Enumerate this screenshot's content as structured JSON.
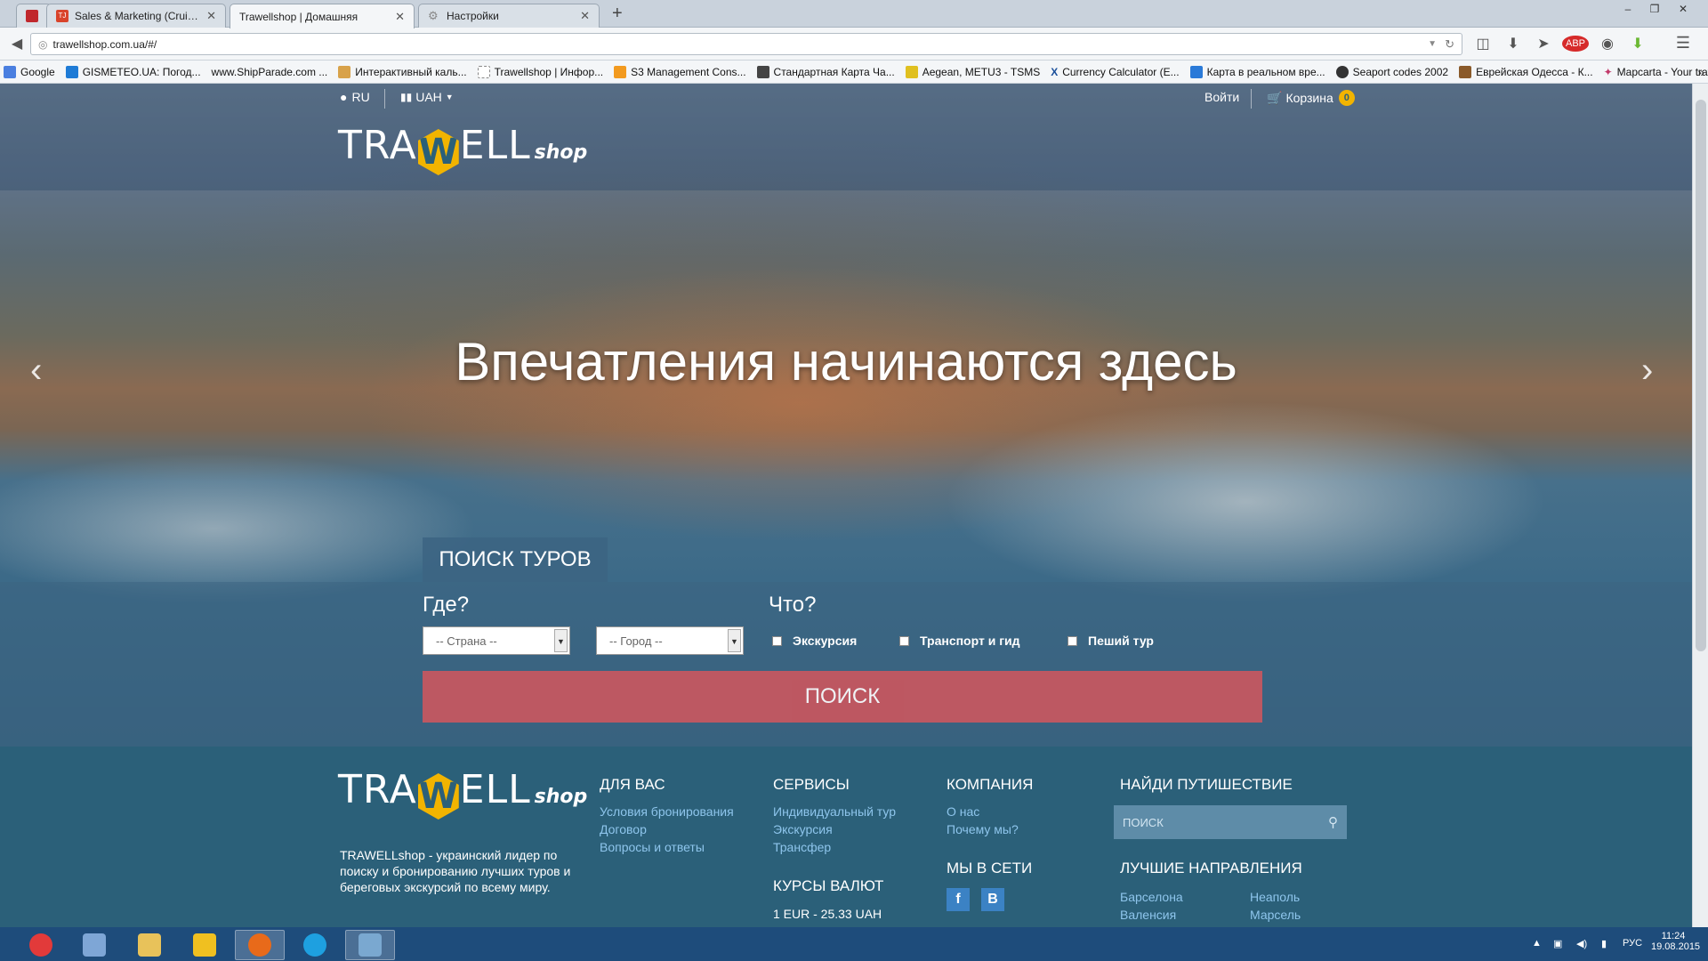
{
  "browser": {
    "tabs": [
      {
        "label": "",
        "icon": "pin-icon",
        "color": "#c0282d"
      },
      {
        "label": "Sales & Marketing (Cruise...",
        "icon": "tj-icon",
        "color": "#d9442b"
      },
      {
        "label": "Trawellshop | Домашняя",
        "icon": "none",
        "color": "#ffffff"
      },
      {
        "label": "Настройки",
        "icon": "gear-icon",
        "color": "#888888"
      }
    ],
    "new_tab": "+",
    "url": "trawellshop.com.ua/#/",
    "bookmarks": [
      {
        "label": "Google",
        "color": "#4a7fe0"
      },
      {
        "label": "GISMETEO.UA: Погод...",
        "color": "#1e7bd6"
      },
      {
        "label": "www.ShipParade.com ...",
        "color": "#ffffff"
      },
      {
        "label": "Интерактивный каль...",
        "color": "#d8a24a"
      },
      {
        "label": "Trawellshop | Инфор...",
        "color": "#ffffff"
      },
      {
        "label": "S3 Management Cons...",
        "color": "#f29a1f"
      },
      {
        "label": "Стандартная Карта Ча...",
        "color": "#444444"
      },
      {
        "label": "Aegean, METU3 - TSMS",
        "color": "#e0c020"
      },
      {
        "label": "Currency Calculator (E...",
        "color": "#1a4f9a"
      },
      {
        "label": "Карта в реальном вре...",
        "color": "#2a7ad8"
      },
      {
        "label": "Seaport codes 2002",
        "color": "#333333"
      },
      {
        "label": "Еврейская Одесса - К...",
        "color": "#8a5a2a"
      },
      {
        "label": "Mapcarta - Your travel...",
        "color": "#c23a6a"
      }
    ]
  },
  "site": {
    "lang": "RU",
    "currency": "UAH",
    "login": "Войти",
    "cart_label": "Корзина",
    "cart_count": "0",
    "logo": {
      "part1": "TRA",
      "w": "W",
      "part2": "ELL",
      "part3": "shop"
    },
    "hero_title": "Впечатления начинаются здесь",
    "search": {
      "tab": "ПОИСК ТУРОВ",
      "where": "Где?",
      "what": "Что?",
      "country_placeholder": "-- Страна --",
      "city_placeholder": "-- Город --",
      "options": [
        "Экскурсия",
        "Транспорт и гид",
        "Пеший тур"
      ],
      "button": "ПОИСК"
    },
    "footer": {
      "about": "TRAWELLshop - украинский лидер по поиску и бронированию лучших туров и береговых экскурсий по всему миру.",
      "for_you": {
        "title": "ДЛЯ ВАС",
        "links": [
          "Условия бронирования",
          "Договор",
          "Вопросы и ответы"
        ]
      },
      "services": {
        "title": "СЕРВИСЫ",
        "links": [
          "Индивидуальный тур",
          "Экскурсия",
          "Трансфер"
        ]
      },
      "rates": {
        "title": "КУРСЫ ВАЛЮТ",
        "value": "1 EUR - 25.33 UAH"
      },
      "company": {
        "title": "КОМПАНИЯ",
        "links": [
          "О нас",
          "Почему мы?"
        ]
      },
      "social": {
        "title": "МЫ В СЕТИ",
        "items": [
          "f",
          "B"
        ]
      },
      "find": {
        "title": "НАЙДИ ПУТИШЕСТВИЕ",
        "placeholder": "ПОИСК"
      },
      "best": {
        "title": "ЛУЧШИЕ НАПРАВЛЕНИЯ",
        "col1": [
          "Барселона",
          "Валенсия"
        ],
        "col2": [
          "Неаполь",
          "Марсель"
        ]
      }
    }
  },
  "taskbar": {
    "apps": [
      {
        "name": "start-button",
        "color": "#e23a3a"
      },
      {
        "name": "calculator-app",
        "color": "#7ea6d6"
      },
      {
        "name": "file-explorer-app",
        "color": "#e8c25a"
      },
      {
        "name": "batman-app",
        "color": "#f0c020"
      },
      {
        "name": "firefox-app",
        "color": "#e86a1a"
      },
      {
        "name": "skype-app",
        "color": "#1ea0e0"
      },
      {
        "name": "remote-desktop-app",
        "color": "#7aa8d0"
      }
    ],
    "lang": "РУС",
    "time": "11:24",
    "date": "19.08.2015"
  }
}
